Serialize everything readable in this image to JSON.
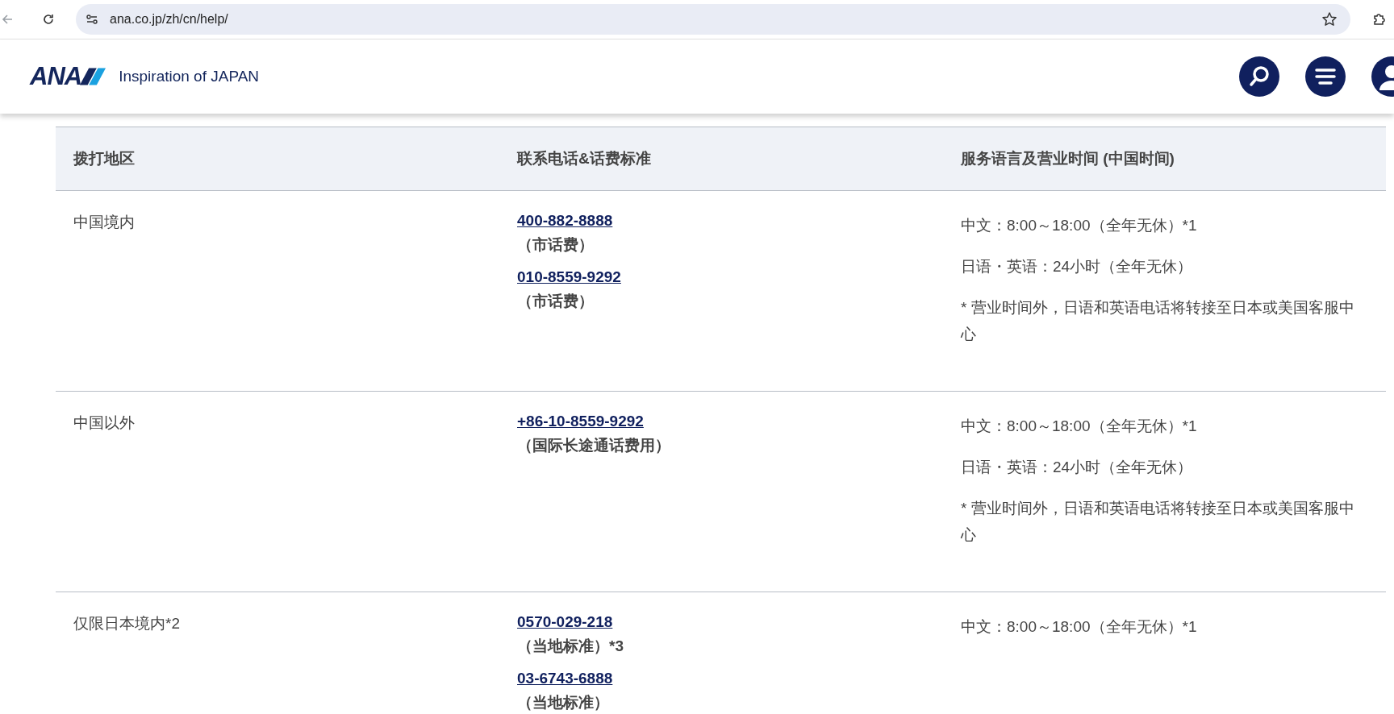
{
  "browser": {
    "url": "ana.co.jp/zh/cn/help/"
  },
  "header": {
    "logo_text": "ANA",
    "tagline": "Inspiration of JAPAN"
  },
  "table": {
    "columns": [
      "拨打地区",
      "联系电话&话费标准",
      "服务语言及营业时间 (中国时间)"
    ],
    "rows": [
      {
        "region": "中国境内",
        "phones": [
          {
            "number": "400-882-8888",
            "note": "（市话费）"
          },
          {
            "number": "010-8559-9292",
            "note": "（市话费）"
          }
        ],
        "hours": [
          "中文：8:00～18:00（全年无休）*1",
          "日语・英语：24小时（全年无休）",
          "* 营业时间外，日语和英语电话将转接至日本或美国客服中心"
        ]
      },
      {
        "region": "中国以外",
        "phones": [
          {
            "number": "+86-10-8559-9292",
            "note": "（国际长途通话费用）"
          }
        ],
        "hours": [
          "中文：8:00～18:00（全年无休）*1",
          "日语・英语：24小时（全年无休）",
          "* 营业时间外，日语和英语电话将转接至日本或美国客服中心"
        ]
      },
      {
        "region": "仅限日本境内*2",
        "phones": [
          {
            "number": "0570-029-218",
            "note": "（当地标准）*3"
          },
          {
            "number": "03-6743-6888",
            "note": "（当地标准）"
          }
        ],
        "hours": [
          "中文：8:00～18:00（全年无休）*1"
        ]
      }
    ]
  }
}
